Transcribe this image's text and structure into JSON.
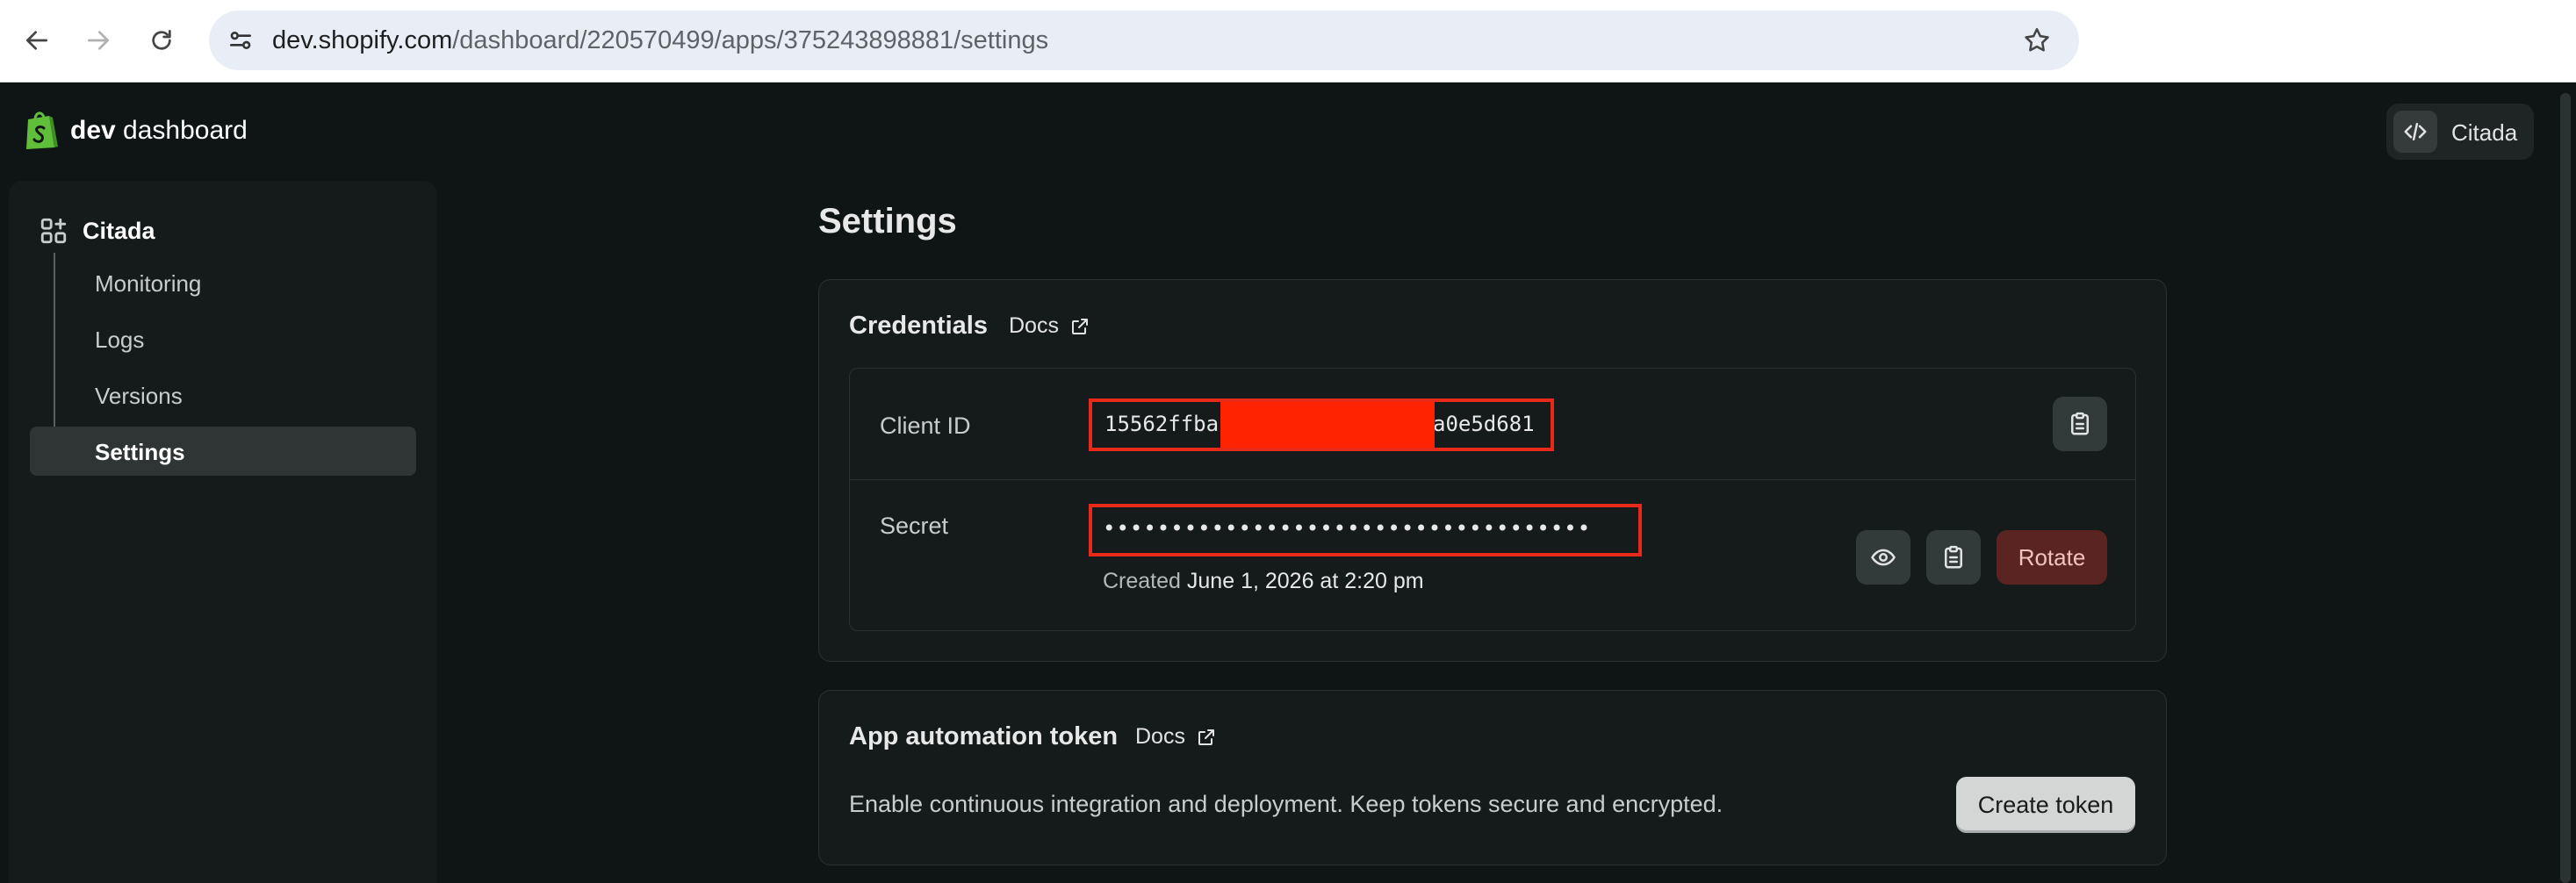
{
  "browser": {
    "url_host": "dev.shopify.com",
    "url_path": "/dashboard/220570499/apps/375243898881/settings",
    "icons": [
      "back-arrow-icon",
      "forward-arrow-icon",
      "reload-icon",
      "site-settings-icon",
      "bookmark-star-icon"
    ]
  },
  "header": {
    "brand_bold": "dev",
    "brand_light": " dashboard",
    "account_name": "Citada",
    "colors": {
      "logo": "#5fbf3a",
      "background": "#0f1414"
    }
  },
  "sidebar": {
    "app_name": "Citada",
    "items": [
      {
        "label": "Monitoring",
        "active": false
      },
      {
        "label": "Logs",
        "active": false
      },
      {
        "label": "Versions",
        "active": false
      },
      {
        "label": "Settings",
        "active": true
      }
    ]
  },
  "main": {
    "title": "Settings",
    "credentials": {
      "title": "Credentials",
      "docs_label": "Docs",
      "client_id_label": "Client ID",
      "client_id_start": "15562ffba",
      "client_id_end": "a0e5d681",
      "secret_label": "Secret",
      "secret_masked": "••••••••••••••••••••••••••••••••••••",
      "created_prefix": "Created",
      "created_date": "June 1, 2026 at 2:20 pm",
      "rotate_label": "Rotate",
      "redaction_color": "#ff2200"
    },
    "token": {
      "title": "App automation token",
      "docs_label": "Docs",
      "description": "Enable continuous integration and deployment. Keep tokens secure and encrypted.",
      "create_label": "Create token"
    }
  }
}
